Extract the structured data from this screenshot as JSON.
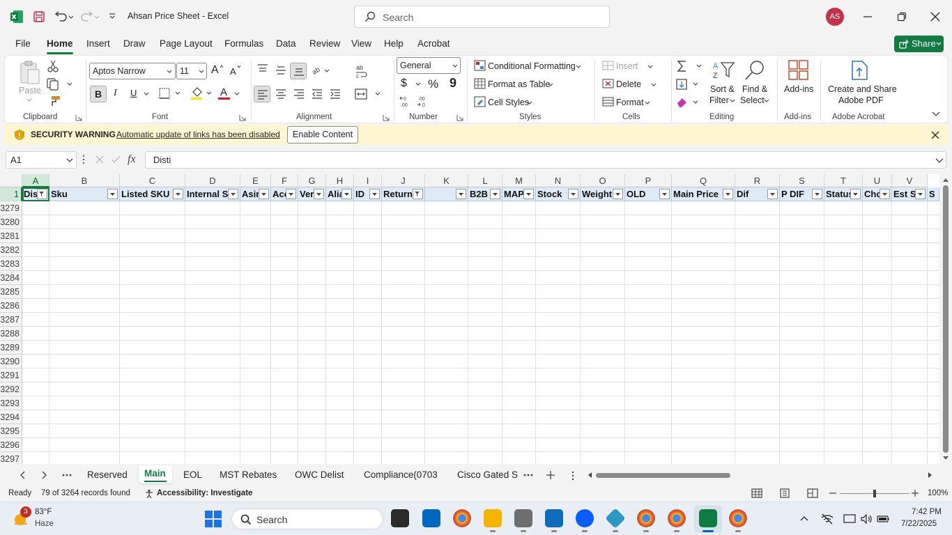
{
  "titlebar": {
    "title": "Ahsan Price Sheet  -  Excel",
    "search_placeholder": "Search",
    "avatar_initials": "AS"
  },
  "menu": {
    "items": [
      "File",
      "Home",
      "Insert",
      "Draw",
      "Page Layout",
      "Formulas",
      "Data",
      "Review",
      "View",
      "Help",
      "Acrobat"
    ],
    "active": "Home",
    "share_label": "Share"
  },
  "ribbon": {
    "clipboard": {
      "paste_label": "Paste",
      "group_label": "Clipboard"
    },
    "font": {
      "font_name": "Aptos Narrow",
      "font_size": "11",
      "group_label": "Font",
      "bold": "B",
      "italic": "I",
      "underline": "U",
      "grow": "A",
      "shrink": "A",
      "color_letter": "A"
    },
    "alignment": {
      "group_label": "Alignment"
    },
    "number": {
      "format": "General",
      "group_label": "Number",
      "currency": "$",
      "percent": "%",
      "comma": "9"
    },
    "styles": {
      "conditional_formatting": "Conditional Formatting",
      "format_as_table": "Format as Table",
      "cell_styles": "Cell Styles",
      "group_label": "Styles"
    },
    "cells": {
      "insert": "Insert",
      "delete": "Delete",
      "format": "Format",
      "group_label": "Cells"
    },
    "editing": {
      "sort_filter_1": "Sort &",
      "sort_filter_2": "Filter",
      "find_select_1": "Find &",
      "find_select_2": "Select",
      "group_label": "Editing"
    },
    "addins": {
      "label": "Add-ins",
      "group_label": "Add-ins"
    },
    "acrobat": {
      "label_1": "Create and Share",
      "label_2": "Adobe PDF",
      "group_label": "Adobe Acrobat"
    }
  },
  "security": {
    "title": "SECURITY WARNING",
    "message": "Automatic update of links has been disabled",
    "button": "Enable Content"
  },
  "formula_bar": {
    "name_box": "A1",
    "fx": "fx",
    "value": "Disti"
  },
  "grid": {
    "columns": [
      "A",
      "B",
      "C",
      "D",
      "E",
      "F",
      "G",
      "H",
      "I",
      "J",
      "K",
      "L",
      "M",
      "N",
      "O",
      "P",
      "Q",
      "R",
      "S",
      "T",
      "U",
      "V"
    ],
    "header_row_number": "1",
    "headers": [
      "Dis",
      "Sku",
      "Listed SKU",
      "Internal S",
      "Asir",
      "Acc",
      "Ver",
      "Alia",
      "ID",
      "Return",
      "",
      "B2B",
      "MAP",
      "Stock",
      "Weight",
      "OLD",
      "Main Price",
      "Dif",
      "P DIF",
      "Status",
      "Cho",
      "Est S",
      "S"
    ],
    "rows": [
      "3279",
      "3280",
      "3281",
      "3282",
      "3283",
      "3284",
      "3285",
      "3286",
      "3287",
      "3288",
      "3289",
      "3290",
      "3291",
      "3292",
      "3293",
      "3294",
      "3295",
      "3296",
      "3297"
    ]
  },
  "sheet_tabs": {
    "tabs": [
      "Reserved",
      "Main",
      "EOL",
      "MST Rebates",
      "OWC Delist",
      "Compliance(0703",
      "Cisco Gated S"
    ],
    "active": "Main"
  },
  "status": {
    "ready": "Ready",
    "records": "79 of 3264 records found",
    "accessibility": "Accessibility: Investigate",
    "zoom": "100%"
  },
  "taskbar": {
    "weather_temp": "83°F",
    "weather_cond": "Haze",
    "weather_badge": "3",
    "search_placeholder": "Search",
    "time": "7:42 PM",
    "date": "7/22/2025"
  }
}
